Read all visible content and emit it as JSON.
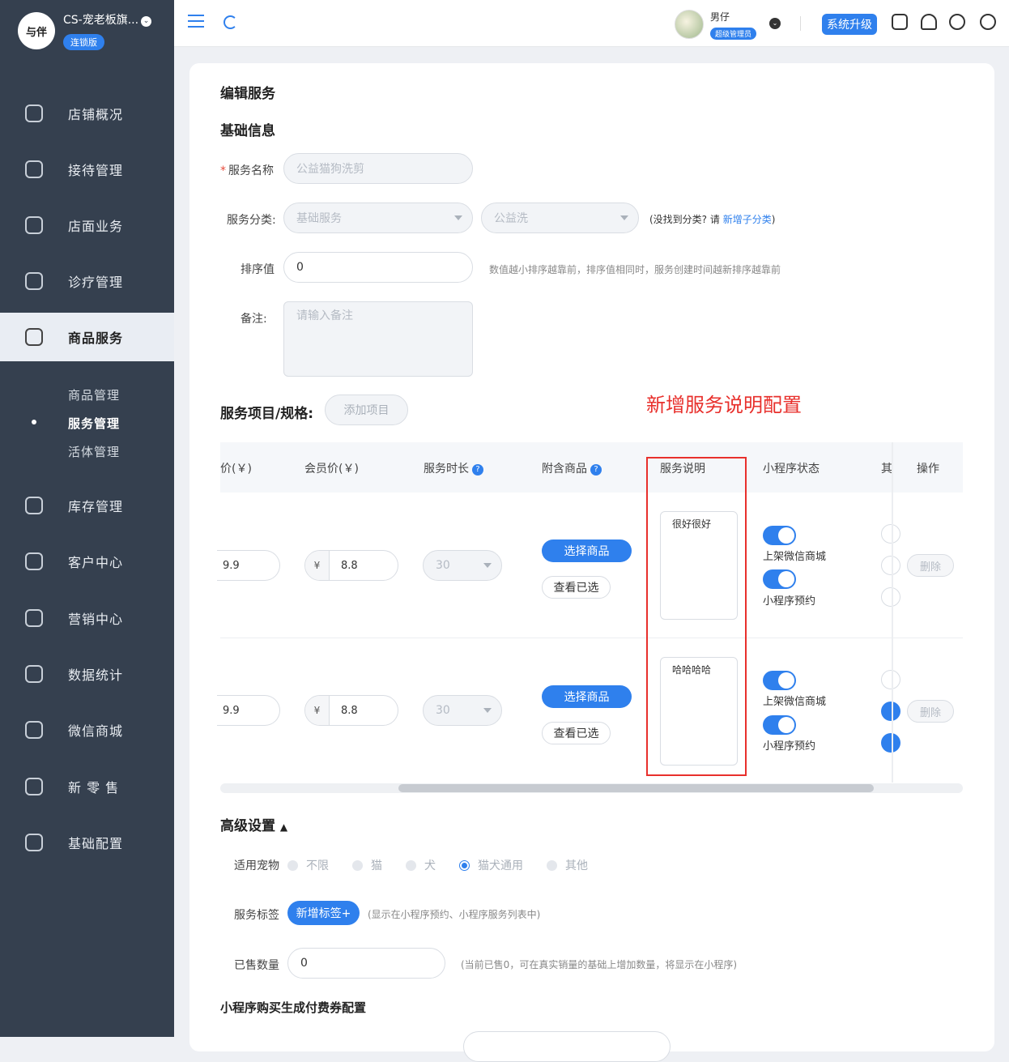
{
  "brand": {
    "logo_text": "与伴",
    "store_name": "CS-宠老板旗...",
    "edition": "连锁版"
  },
  "nav": {
    "items": [
      "店铺概况",
      "接待管理",
      "店面业务",
      "诊疗管理",
      "商品服务",
      "库存管理",
      "客户中心",
      "营销中心",
      "数据统计",
      "微信商城",
      "新 零 售",
      "基础配置"
    ],
    "active": "商品服务",
    "sub_items": [
      "商品管理",
      "服务管理",
      "活体管理"
    ],
    "sub_selected": "服务管理"
  },
  "header": {
    "user_name": "男仔",
    "user_role": "超级管理员",
    "upgrade_label": "系统升级"
  },
  "page": {
    "title": "编辑服务",
    "basic_title": "基础信息",
    "name_label": "服务名称",
    "name_value": "公益猫狗洗剪",
    "category_label": "服务分类:",
    "category_1": "基础服务",
    "category_2": "公益洗",
    "category_hint_prefix": "(没找到分类? 请",
    "category_hint_link": "新增子分类",
    "category_hint_suffix": ")",
    "sort_label": "排序值",
    "sort_value": "0",
    "sort_hint": "数值越小排序越靠前，排序值相同时，服务创建时间越新排序越靠前",
    "remark_label": "备注:",
    "remark_placeholder": "请输入备注",
    "items_title": "服务项目/规格:",
    "add_item_label": "添加项目",
    "annotation": "新增服务说明配置"
  },
  "table": {
    "headers": [
      "价(￥)",
      "会员价(￥)",
      "服务时长",
      "附含商品",
      "服务说明",
      "小程序状态",
      "其",
      "操作"
    ],
    "rows": [
      {
        "price": "9.9",
        "member_price": "8.8",
        "duration": "30",
        "description": "很好很好"
      },
      {
        "price": "9.9",
        "member_price": "8.8",
        "duration": "30",
        "description": "哈哈哈哈"
      }
    ],
    "currency": "¥",
    "select_goods_label": "选择商品",
    "view_selected_label": "查看已选",
    "status_1": "上架微信商城",
    "status_2": "小程序预约",
    "delete_label": "删除",
    "toggles_on": [
      [
        true,
        true
      ],
      [
        true,
        true
      ]
    ]
  },
  "advanced": {
    "title": "高级设置",
    "pet_label": "适用宠物",
    "pet_options": [
      "不限",
      "猫",
      "犬",
      "猫犬通用",
      "其他"
    ],
    "pet_selected": "猫犬通用",
    "tag_label": "服务标签",
    "add_tag_label": "新增标签+",
    "tag_hint": "(显示在小程序预约、小程序服务列表中)",
    "sold_label": "已售数量",
    "sold_value": "0",
    "sold_hint": "(当前已售0，可在真实销量的基础上增加数量，将显示在小程序)",
    "coupon_title": "小程序购买生成付费券配置"
  }
}
